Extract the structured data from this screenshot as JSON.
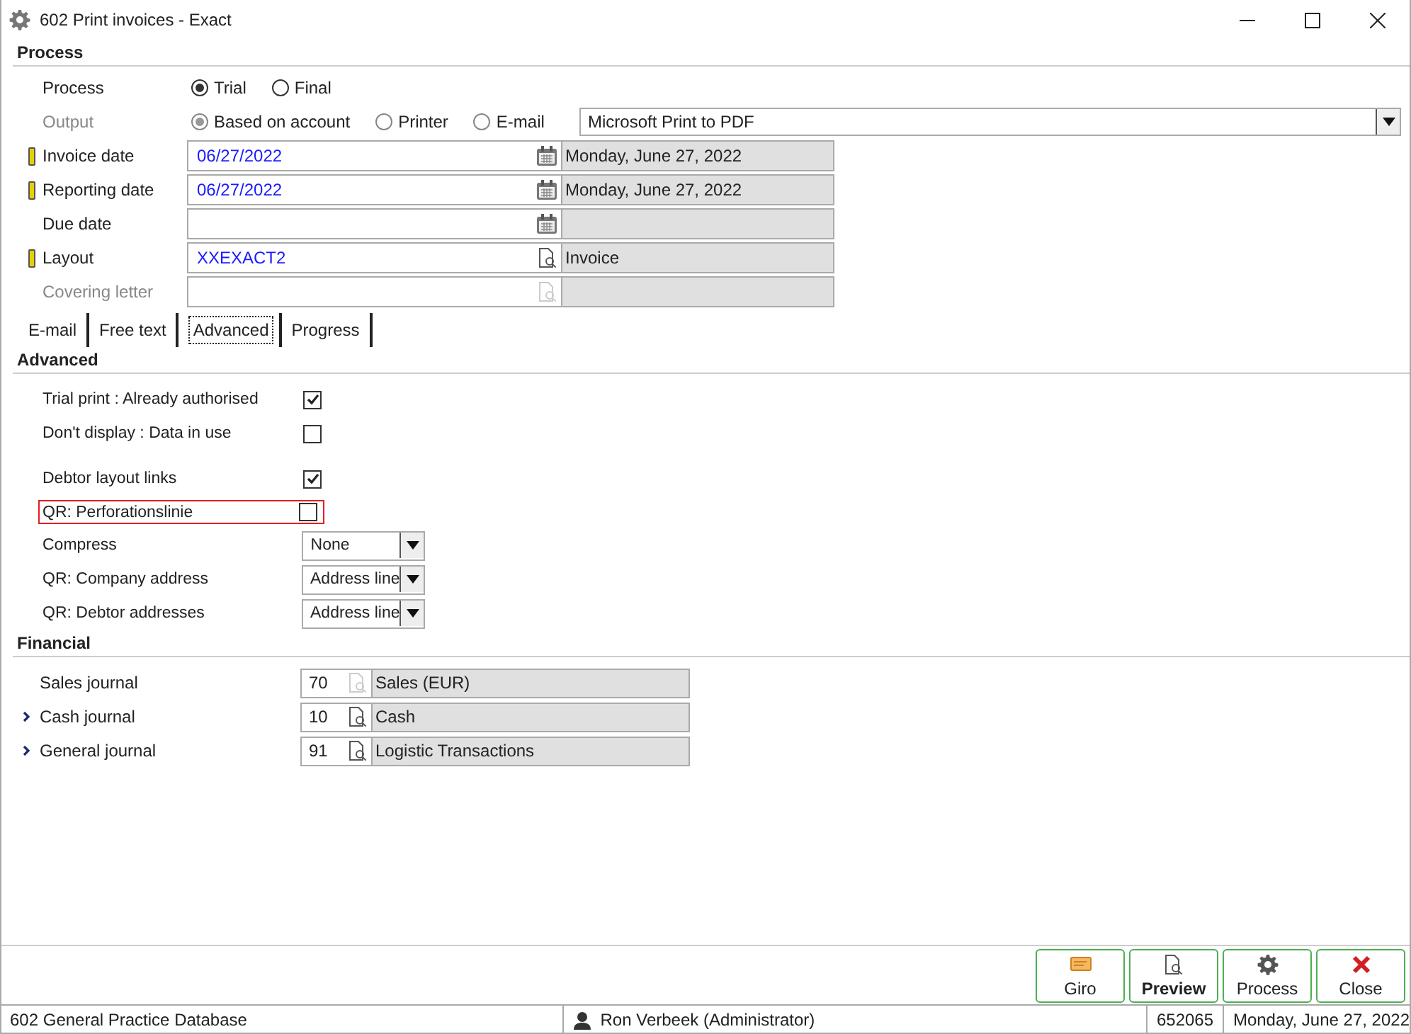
{
  "window": {
    "title": "602 Print invoices - Exact"
  },
  "process_section": {
    "title": "Process",
    "process": {
      "label": "Process",
      "disabled": false,
      "options": [
        {
          "label": "Trial",
          "selected": true
        },
        {
          "label": "Final",
          "selected": false
        }
      ]
    },
    "output": {
      "label": "Output",
      "disabled": true,
      "options": [
        {
          "label": "Based on account",
          "selected": true
        },
        {
          "label": "Printer",
          "selected": false
        },
        {
          "label": "E-mail",
          "selected": false
        }
      ],
      "printer": "Microsoft Print to PDF"
    },
    "fields": [
      {
        "label": "Invoice date",
        "kind": "date",
        "required": true,
        "disabled": false,
        "value": "06/27/2022",
        "description": "Monday, June 27, 2022"
      },
      {
        "label": "Reporting date",
        "kind": "date",
        "required": true,
        "disabled": false,
        "value": "06/27/2022",
        "description": "Monday, June 27, 2022"
      },
      {
        "label": "Due date",
        "kind": "date",
        "required": false,
        "disabled": false
      },
      {
        "label": "Layout",
        "kind": "lookup",
        "required": true,
        "disabled": false,
        "value": "XXEXACT2",
        "description": "Invoice"
      },
      {
        "label": "Covering letter",
        "kind": "lookup",
        "required": false,
        "disabled": true
      }
    ]
  },
  "tabs": [
    {
      "label": "E-mail",
      "selected": false
    },
    {
      "label": "Free text",
      "selected": false
    },
    {
      "label": "Advanced",
      "selected": true
    },
    {
      "label": "Progress",
      "selected": false
    }
  ],
  "advanced_section": {
    "title": "Advanced",
    "groups": [
      [
        {
          "kind": "checkbox",
          "label": "Trial print : Already authorised",
          "checked": true,
          "highlighted": false
        },
        {
          "kind": "checkbox",
          "label": "Don't display : Data in use",
          "checked": false,
          "highlighted": false
        }
      ],
      [
        {
          "kind": "checkbox",
          "label": "Debtor layout links",
          "checked": true,
          "highlighted": false
        },
        {
          "kind": "checkbox",
          "label": "QR: Perforationslinie",
          "checked": false,
          "highlighted": true
        },
        {
          "kind": "dropdown",
          "label": "Compress",
          "value": "None"
        },
        {
          "kind": "dropdown",
          "label": "QR: Company address",
          "value": "Address line"
        },
        {
          "kind": "dropdown",
          "label": "QR: Debtor addresses",
          "value": "Address line"
        }
      ]
    ]
  },
  "financial_section": {
    "title": "Financial",
    "journals": [
      {
        "label": "Sales journal",
        "expandable": false,
        "code": "70",
        "lookup_disabled": true,
        "description": "Sales (EUR)"
      },
      {
        "label": "Cash journal",
        "expandable": true,
        "code": "10",
        "lookup_disabled": false,
        "description": "Cash"
      },
      {
        "label": "General journal",
        "expandable": true,
        "code": "91",
        "lookup_disabled": false,
        "description": "Logistic Transactions"
      }
    ]
  },
  "buttons": [
    {
      "label": "Giro",
      "kind": "giro",
      "default": false
    },
    {
      "label": "Preview",
      "kind": "preview",
      "default": true
    },
    {
      "label": "Process",
      "kind": "process",
      "default": false
    },
    {
      "label": "Close",
      "kind": "close",
      "default": false
    }
  ],
  "status_bar": {
    "database": "602 General Practice Database",
    "user": "Ron Verbeek (Administrator)",
    "number": "652065",
    "date": "Monday, June 27, 2022"
  }
}
